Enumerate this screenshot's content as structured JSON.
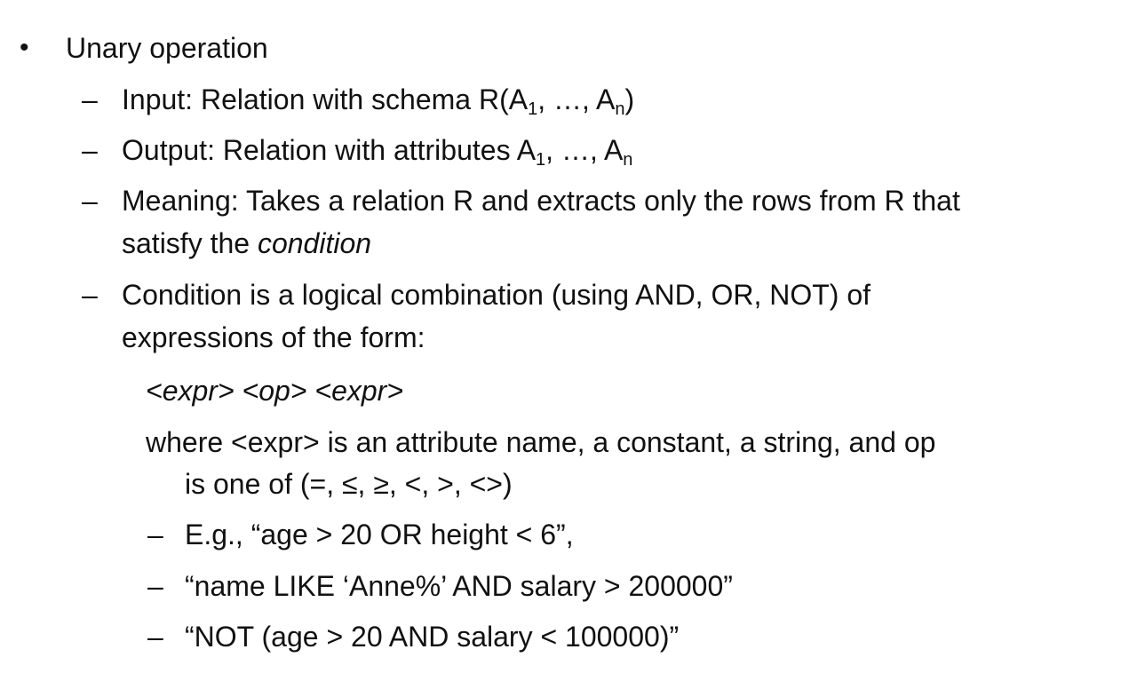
{
  "bullet": {
    "marker": "•",
    "text": "Unary operation"
  },
  "items": [
    {
      "marker": "–",
      "input": {
        "prefix": "Input:  Relation with schema R(A",
        "sub1": "1",
        "mid": ", …, A",
        "sub2": "n",
        "suffix": ")"
      }
    },
    {
      "marker": "–",
      "output": {
        "prefix": "Output:  Relation with attributes A",
        "sub1": "1",
        "mid": ", …, A",
        "sub2": "n"
      }
    },
    {
      "marker": "–",
      "meaning": {
        "line1": "Meaning: Takes a relation R and extracts only the rows from R that",
        "line2_prefix": "satisfy the ",
        "line2_italic": "condition"
      }
    },
    {
      "marker": "–",
      "condition": {
        "line1": "Condition is a logical combination (using AND, OR, NOT) of",
        "line2": "expressions of the form:"
      }
    }
  ],
  "expr_form": "<expr> <op> <expr>",
  "where": {
    "line1": "where <expr> is an attribute name, a constant, a string, and op",
    "line2": "is one of (=, ≤, ≥, <, >, <>)"
  },
  "examples": [
    {
      "marker": "–",
      "text": "E.g., “age > 20 OR height < 6”,"
    },
    {
      "marker": "–",
      "text": "“name LIKE ‘Anne%’ AND salary > 200000”"
    },
    {
      "marker": "–",
      "text": "“NOT (age > 20 AND salary < 100000)”"
    }
  ]
}
